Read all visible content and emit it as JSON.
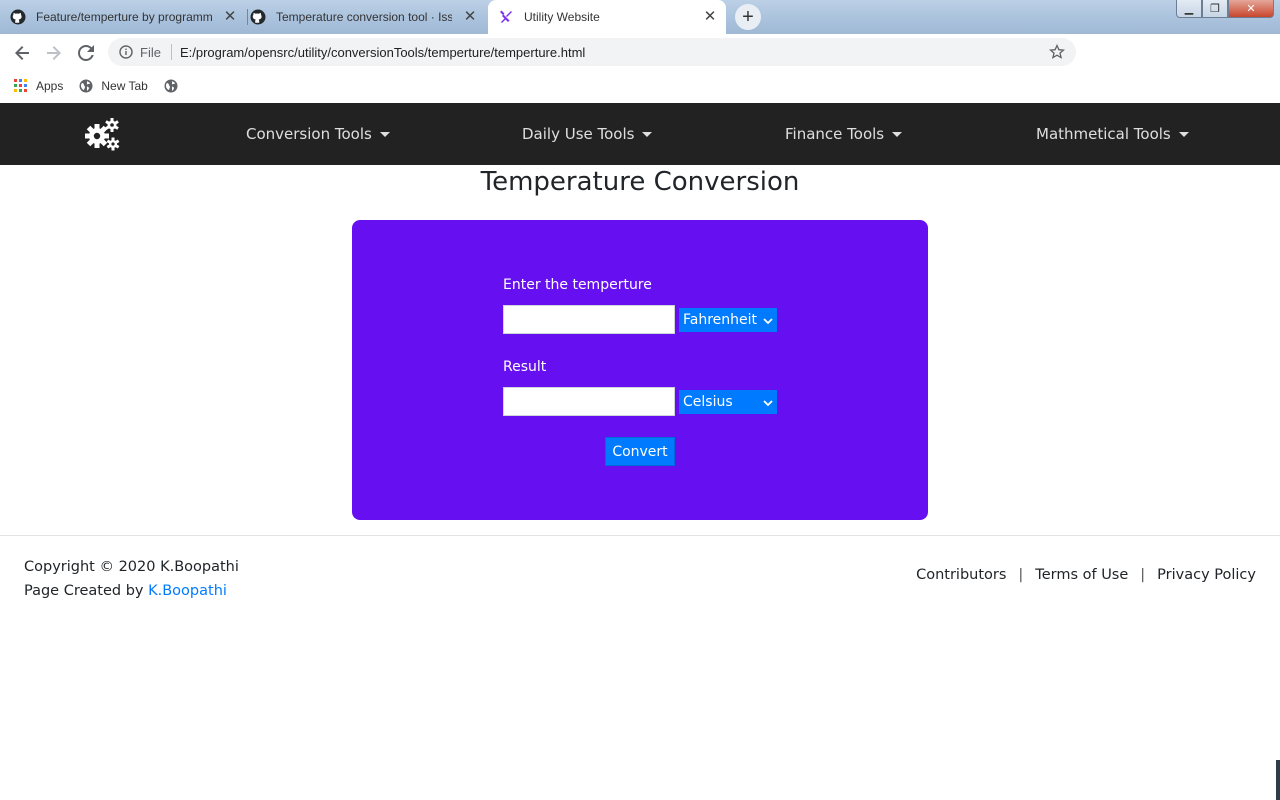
{
  "browser": {
    "tabs": [
      {
        "title": "Feature/temperture by programm",
        "icon": "github-icon",
        "active": false
      },
      {
        "title": "Temperature conversion tool · Iss",
        "icon": "github-icon",
        "active": false
      },
      {
        "title": "Utility Website",
        "icon": "tools-icon",
        "active": true
      }
    ],
    "address": {
      "scheme_label": "File",
      "url": "E:/program/opensrc/utility/conversionTools/temperture/temperture.html"
    },
    "bookmarks": [
      {
        "label": "Apps",
        "icon": "apps-grid-icon"
      },
      {
        "label": "New Tab",
        "icon": "globe-icon"
      },
      {
        "label": "",
        "icon": "globe-icon"
      }
    ]
  },
  "navbar": {
    "brand_icon": "gears-icon",
    "items": [
      {
        "label": "Conversion Tools"
      },
      {
        "label": "Daily Use Tools"
      },
      {
        "label": "Finance Tools"
      },
      {
        "label": "Mathmetical Tools"
      }
    ],
    "background": "#222222"
  },
  "page": {
    "title": "Temperature Conversion"
  },
  "converter": {
    "card_color": "#6610f2",
    "input_label": "Enter the temperture",
    "input_value": "",
    "input_unit": "Fahrenheit",
    "result_label": "Result",
    "result_value": "",
    "result_unit": "Celsius",
    "button_label": "Convert",
    "accent": "#007bff"
  },
  "footer": {
    "copyright": "Copyright © 2020 K.Boopathi",
    "created_prefix": "Page Created by ",
    "author_link": "K.Boopathi",
    "links": [
      {
        "label": "Contributors"
      },
      {
        "label": "Terms of Use"
      },
      {
        "label": "Privacy Policy"
      }
    ]
  }
}
